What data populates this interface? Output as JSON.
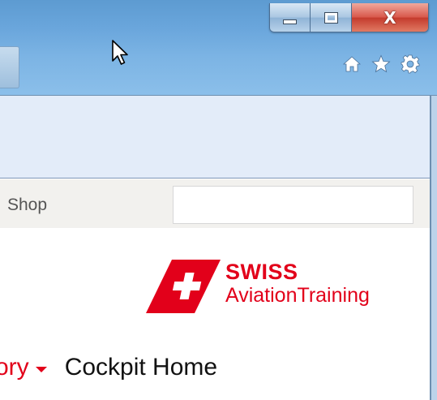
{
  "window": {
    "controls": {
      "minimize": "minimize",
      "maximize": "maximize",
      "close": "X"
    }
  },
  "toolbar": {
    "icons": [
      "home-icon",
      "star-icon",
      "gear-icon"
    ]
  },
  "navbar": {
    "shop_label": "Shop",
    "search_value": ""
  },
  "logo": {
    "line1": "SWISS",
    "line2": "AviationTraining"
  },
  "menu": {
    "partial_item": "ory",
    "cockpit_home": "Cockpit Home"
  },
  "colors": {
    "brand_red": "#e2001a",
    "titlebar_blue": "#6aa6dc",
    "infobar": "#e3ecf9",
    "navbar_bg": "#f2f1ee"
  }
}
